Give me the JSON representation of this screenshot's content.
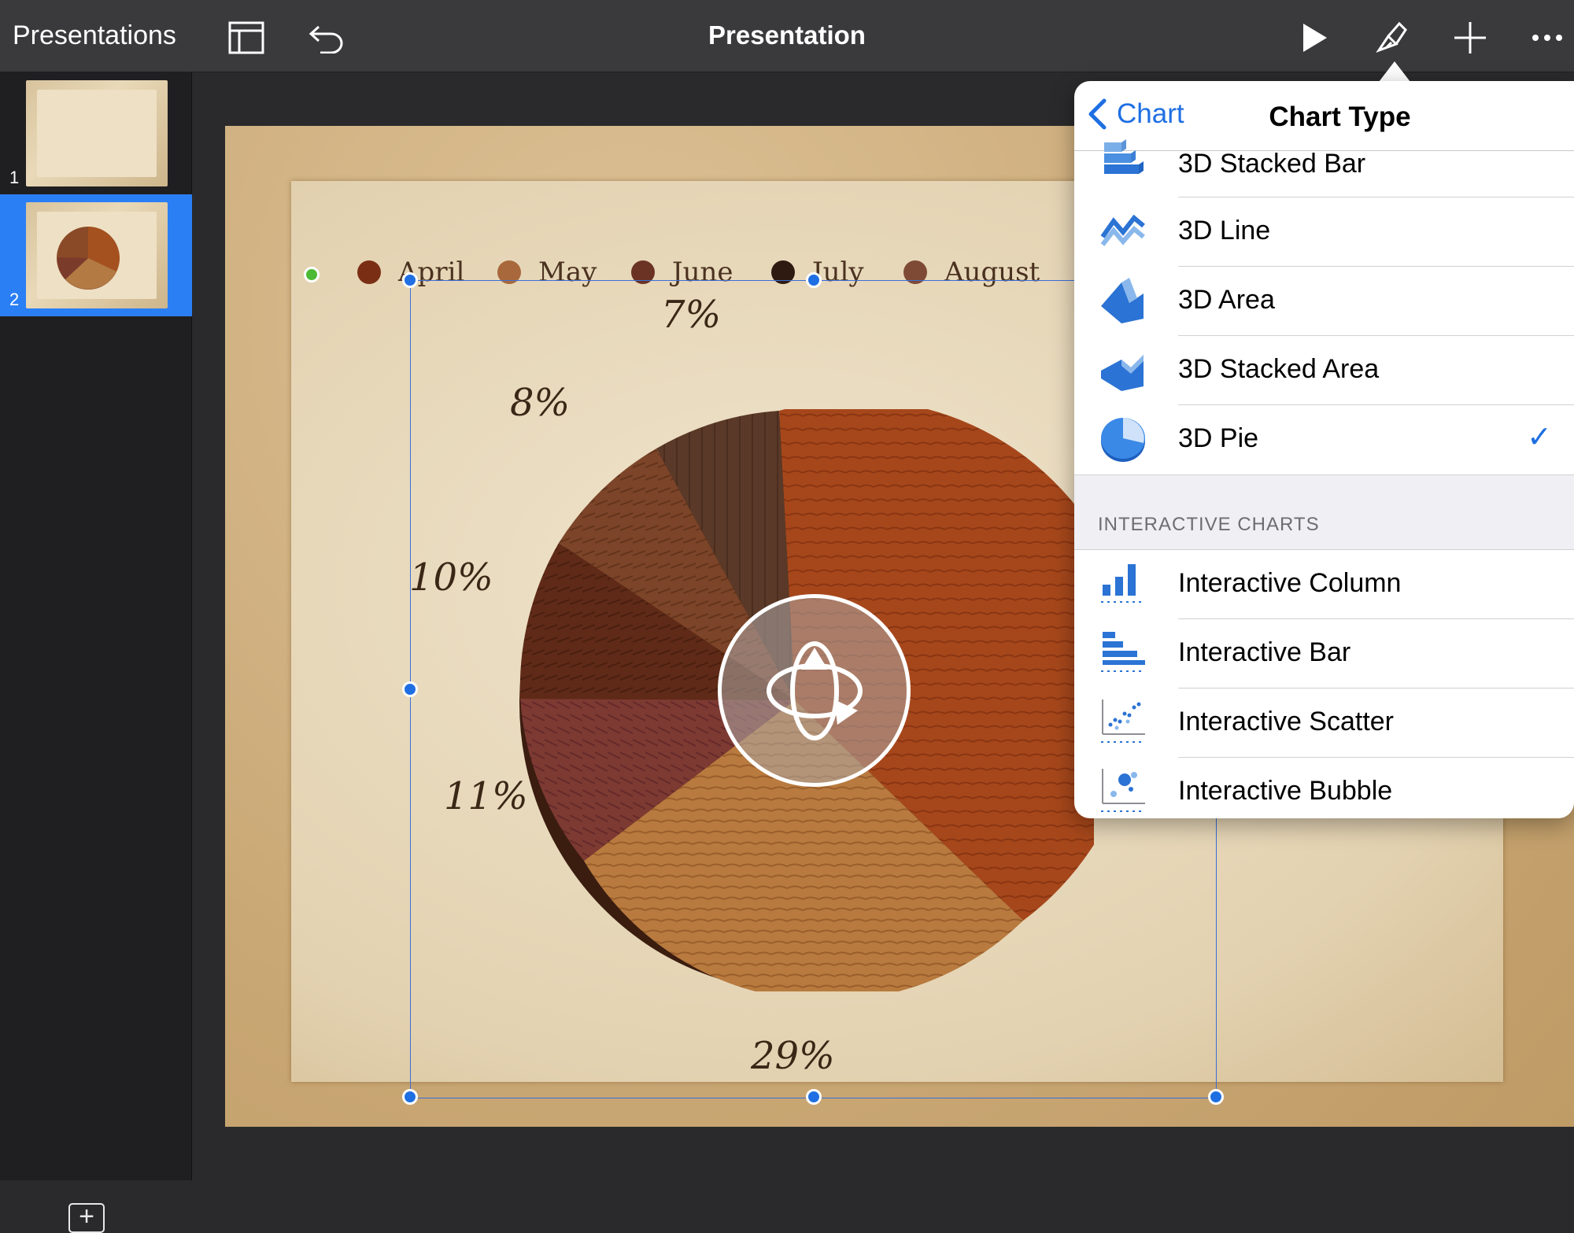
{
  "topbar": {
    "back_label": "Presentations",
    "document_title": "Presentation"
  },
  "navigator": {
    "slides": [
      {
        "number": "1",
        "selected": false
      },
      {
        "number": "2",
        "selected": true
      }
    ]
  },
  "slide": {
    "legend": [
      {
        "label": "April",
        "color": "#7a2f14"
      },
      {
        "label": "May",
        "color": "#a8683b"
      },
      {
        "label": "June",
        "color": "#6b3324"
      },
      {
        "label": "July",
        "color": "#2f1a12"
      },
      {
        "label": "August",
        "color": "#7e4a36"
      }
    ],
    "percent_labels": [
      "7%",
      "8%",
      "10%",
      "11%",
      "29%"
    ]
  },
  "popover": {
    "back_label": "Chart",
    "title": "Chart Type",
    "chart_types": [
      {
        "label": "3D Stacked Bar",
        "icon": "3d-stacked-bar-icon",
        "selected": false
      },
      {
        "label": "3D Line",
        "icon": "3d-line-icon",
        "selected": false
      },
      {
        "label": "3D Area",
        "icon": "3d-area-icon",
        "selected": false
      },
      {
        "label": "3D Stacked Area",
        "icon": "3d-stacked-area-icon",
        "selected": false
      },
      {
        "label": "3D Pie",
        "icon": "3d-pie-icon",
        "selected": true
      }
    ],
    "section_header": "INTERACTIVE CHARTS",
    "interactive_types": [
      {
        "label": "Interactive Column",
        "icon": "interactive-column-icon"
      },
      {
        "label": "Interactive Bar",
        "icon": "interactive-bar-icon"
      },
      {
        "label": "Interactive Scatter",
        "icon": "interactive-scatter-icon"
      },
      {
        "label": "Interactive Bubble",
        "icon": "interactive-bubble-icon"
      }
    ],
    "accent_color": "#1f6fe3"
  }
}
